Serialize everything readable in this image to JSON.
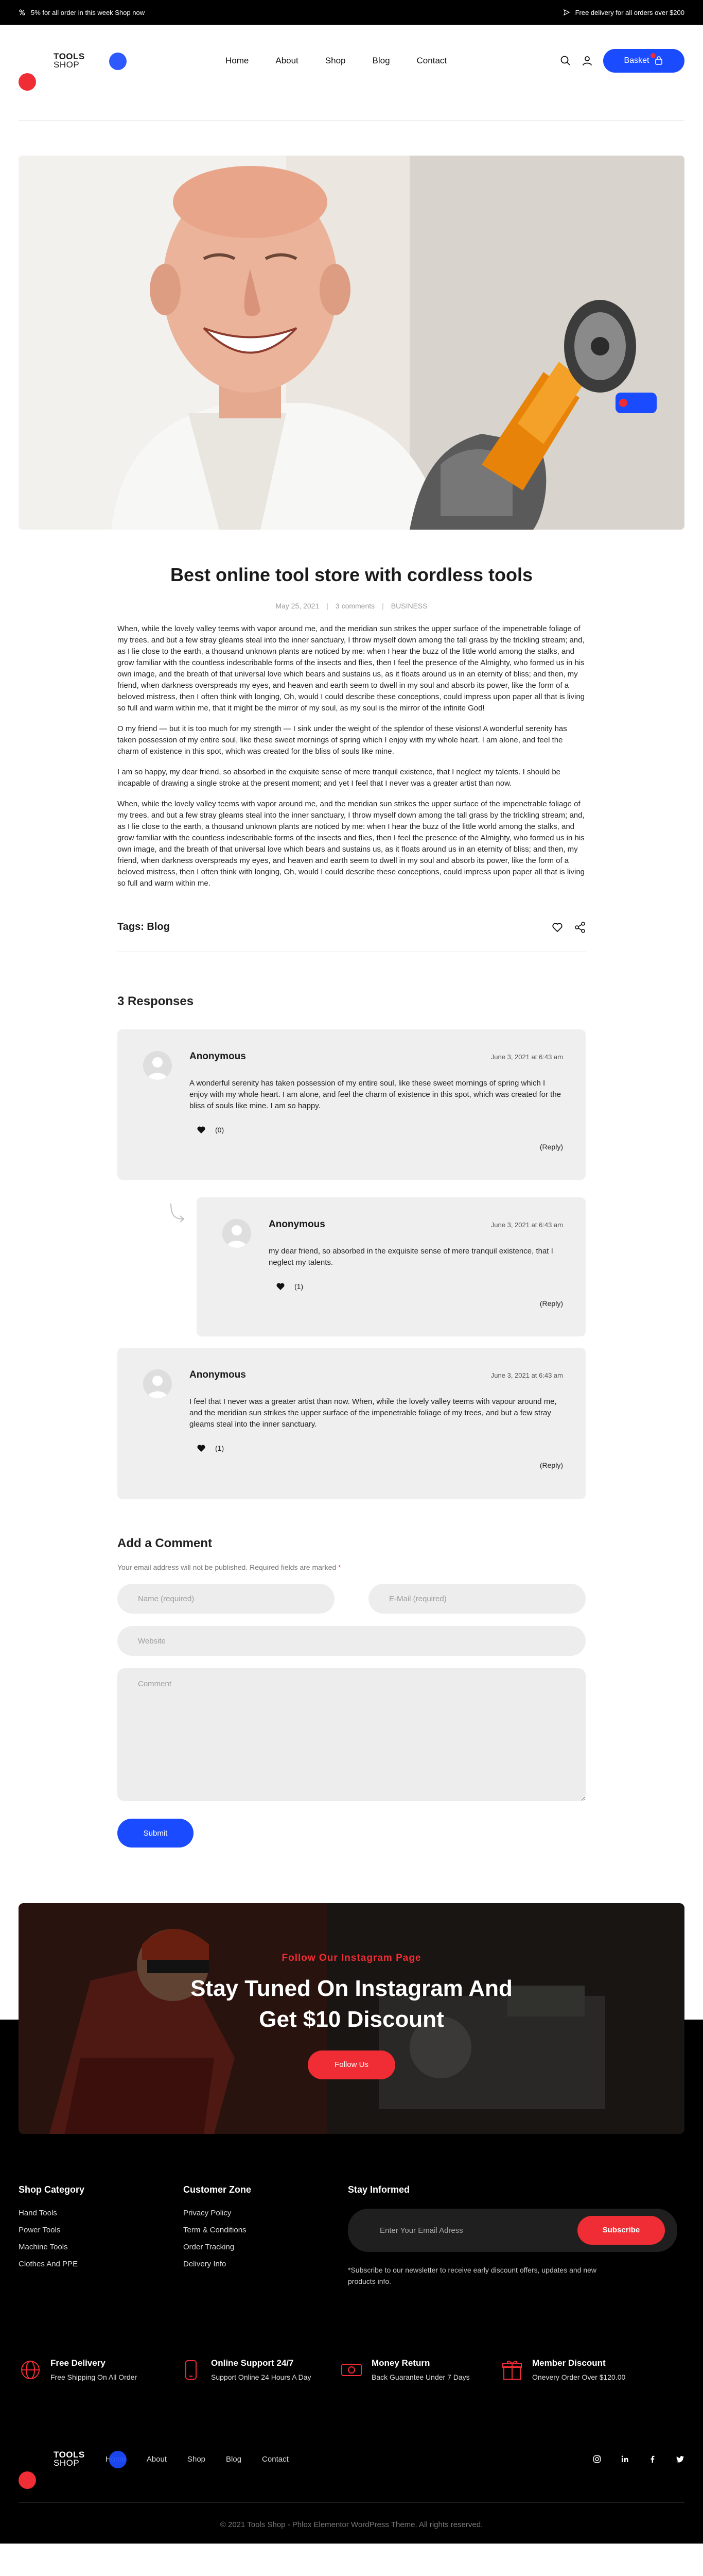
{
  "topbar": {
    "promo": "5% for all order in this week Shop now",
    "delivery": "Free delivery for all orders over $200"
  },
  "header": {
    "logo_line1": "TOOLS",
    "logo_line2": "SHOP",
    "nav": [
      "Home",
      "About",
      "Shop",
      "Blog",
      "Contact"
    ],
    "basket_label": "Basket",
    "basket_count": "0"
  },
  "post": {
    "title": "Best online tool store with cordless tools",
    "date": "May 25, 2021",
    "comments": "3 comments",
    "category": "BUSINESS",
    "paragraphs": [
      "When, while the lovely valley teems with vapor around me, and the meridian sun strikes the upper surface of the impenetrable foliage of my trees, and but a few stray gleams steal into the inner sanctuary, I throw myself down among the tall grass by the trickling stream; and, as I lie close to the earth, a thousand unknown plants are noticed by me: when I hear the buzz of the little world among the stalks, and grow familiar with the countless indescribable forms of the insects and flies, then I feel the presence of the Almighty, who formed us in his own image, and the breath of that universal love which bears and sustains us, as it floats around us in an eternity of bliss; and then, my friend, when darkness overspreads my eyes, and heaven and earth seem to dwell in my soul and absorb its power, like the form of a beloved mistress, then I often think with longing, Oh, would I could describe these conceptions, could impress upon paper all that is living so full and warm within me, that it might be the mirror of my soul, as my soul is the mirror of the infinite God!",
      "O my friend — but it is too much for my strength — I sink under the weight of the splendor of these visions! A wonderful serenity has taken possession of my entire soul, like these sweet mornings of spring which I enjoy with my whole heart. I am alone, and feel the charm of existence in this spot, which was created for the bliss of souls like mine.",
      "I am so happy, my dear friend, so absorbed in the exquisite sense of mere tranquil existence, that I neglect my talents. I should be incapable of drawing a single stroke at the present moment; and yet I feel that I never was a greater artist than now.",
      "When, while the lovely valley teems with vapor around me, and the meridian sun strikes the upper surface of the impenetrable foliage of my trees, and but a few stray gleams steal into the inner sanctuary, I throw myself down among the tall grass by the trickling stream; and, as I lie close to the earth, a thousand unknown plants are noticed by me: when I hear the buzz of the little world among the stalks, and grow familiar with the countless indescribable forms of the insects and flies, then I feel the presence of the Almighty, who formed us in his own image, and the breath of that universal love which bears and sustains us, as it floats around us in an eternity of bliss; and then, my friend, when darkness overspreads my eyes, and heaven and earth seem to dwell in my soul and absorb its power, like the form of a beloved mistress, then I often think with longing, Oh, would I could describe these conceptions, could impress upon paper all that is living so full and warm within me."
    ],
    "tags_label": "Tags:",
    "tag": "Blog"
  },
  "responses": {
    "title": "3 Responses",
    "reply_label": "(Reply)",
    "items": [
      {
        "name": "Anonymous",
        "date": "June 3, 2021 at 6:43 am",
        "text": "A wonderful serenity has taken possession of my entire soul, like these sweet mornings of spring which I enjoy with my whole heart. I am alone, and feel the charm of existence in this spot, which was created for the bliss of souls like mine. I am so happy.",
        "likes": "(0)"
      },
      {
        "name": "Anonymous",
        "date": "June 3, 2021 at 6:43 am",
        "text": "my dear friend, so absorbed in the exquisite sense of mere tranquil existence, that I neglect my talents.",
        "likes": "(1)"
      },
      {
        "name": "Anonymous",
        "date": "June 3, 2021 at 6:43 am",
        "text": "I feel that I never was a greater artist than now. When, while the lovely valley teems with vapour around me, and the meridian sun strikes the upper surface of the impenetrable foliage of my trees, and but a few stray gleams steal into the inner sanctuary.",
        "likes": "(1)"
      }
    ]
  },
  "comment_form": {
    "title": "Add a Comment",
    "note": "Your email address will not be published. Required fields are marked",
    "required_mark": "*",
    "name_placeholder": "Name (required)",
    "email_placeholder": "E-Mail (required)",
    "website_placeholder": "Website",
    "comment_placeholder": "Comment",
    "submit_label": "Submit"
  },
  "instagram": {
    "eyebrow": "Follow Our Instagram Page",
    "title_line1": "Stay Tuned On Instagram And",
    "title_line2": "Get $10 Discount",
    "button": "Follow Us"
  },
  "footer": {
    "shop_category": {
      "title": "Shop Category",
      "items": [
        "Hand Tools",
        "Power Tools",
        "Machine Tools",
        "Clothes And PPE"
      ]
    },
    "customer_zone": {
      "title": "Customer Zone",
      "items": [
        "Privacy Policy",
        "Term & Conditions",
        "Order Tracking",
        "Delivery Info"
      ]
    },
    "newsletter": {
      "title": "Stay Informed",
      "placeholder": "Enter Your Email Adress",
      "button": "Subscribe",
      "note": "*Subscribe to our newsletter to receive early discount offers, updates and new products info."
    },
    "features": [
      {
        "title": "Free Delivery",
        "text": "Free Shipping On All Order",
        "icon": "globe-icon"
      },
      {
        "title": "Online Support 24/7",
        "text": "Support Online 24 Hours A Day",
        "icon": "phone-icon"
      },
      {
        "title": "Money Return",
        "text": "Back Guarantee Under 7 Days",
        "icon": "money-icon"
      },
      {
        "title": "Member Discount",
        "text": "Onevery Order Over $120.00",
        "icon": "gift-icon"
      }
    ],
    "bottom_nav": [
      "Home",
      "About",
      "Shop",
      "Blog",
      "Contact"
    ],
    "socials": [
      "instagram-icon",
      "linkedin-icon",
      "facebook-icon",
      "twitter-icon"
    ],
    "copyright": "© 2021 Tools Shop - Phlox Elementor WordPress Theme. All rights reserved."
  },
  "colors": {
    "accent_blue": "#1b4bff",
    "accent_red": "#f02d34"
  }
}
